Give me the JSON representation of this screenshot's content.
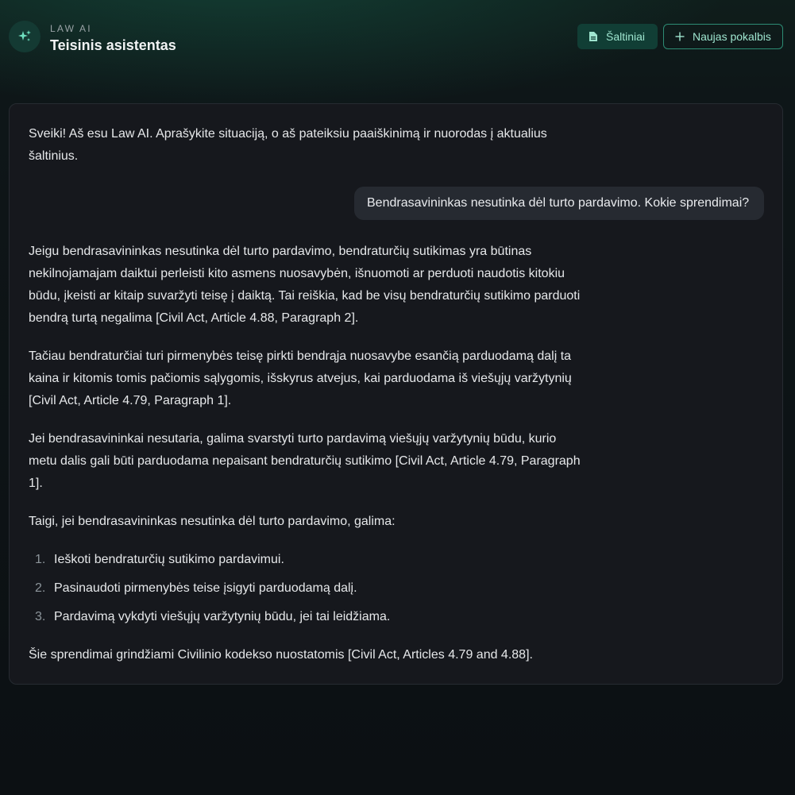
{
  "header": {
    "brand_small": "LAW AI",
    "title": "Teisinis asistentas",
    "sources_button": "Šaltiniai",
    "new_chat_button": "Naujas pokalbis",
    "accent_color": "#2d8c74"
  },
  "chat": {
    "greeting": "Sveiki! Aš esu Law AI. Aprašykite situaciją, o aš pateiksiu paaiškinimą ir nuorodas į aktualius šaltinius.",
    "user_message": "Bendrasavininkas nesutinka dėl turto pardavimo. Kokie sprendimai?",
    "answer": {
      "p1": "Jeigu bendrasavininkas nesutinka dėl turto pardavimo, bendraturčių sutikimas yra būtinas nekilnojamajam daiktui perleisti kito asmens nuosavybėn, išnuomoti ar perduoti naudotis kitokiu būdu, įkeisti ar kitaip suvaržyti teisę į daiktą. Tai reiškia, kad be visų bendraturčių sutikimo parduoti bendrą turtą negalima [Civil Act, Article 4.88, Paragraph 2].",
      "p2": "Tačiau bendraturčiai turi pirmenybės teisę pirkti bendrąja nuosavybe esančią parduodamą dalį ta kaina ir kitomis tomis pačiomis sąlygomis, išskyrus atvejus, kai parduodama iš viešųjų varžytynių [Civil Act, Article 4.79, Paragraph 1].",
      "p3": "Jei bendrasavininkai nesutaria, galima svarstyti turto pardavimą viešųjų varžytynių būdu, kurio metu dalis gali būti parduodama nepaisant bendraturčių sutikimo [Civil Act, Article 4.79, Paragraph 1].",
      "p4": "Taigi, jei bendrasavininkas nesutinka dėl turto pardavimo, galima:",
      "list": [
        {
          "num": "1.",
          "text": "Ieškoti bendraturčių sutikimo pardavimui."
        },
        {
          "num": "2.",
          "text": "Pasinaudoti pirmenybės teise įsigyti parduodamą dalį."
        },
        {
          "num": "3.",
          "text": "Pardavimą vykdyti viešųjų varžytynių būdu, jei tai leidžiama."
        }
      ],
      "p5": "Šie sprendimai grindžiami Civilinio kodekso nuostatomis [Civil Act, Articles 4.79 and 4.88]."
    }
  }
}
